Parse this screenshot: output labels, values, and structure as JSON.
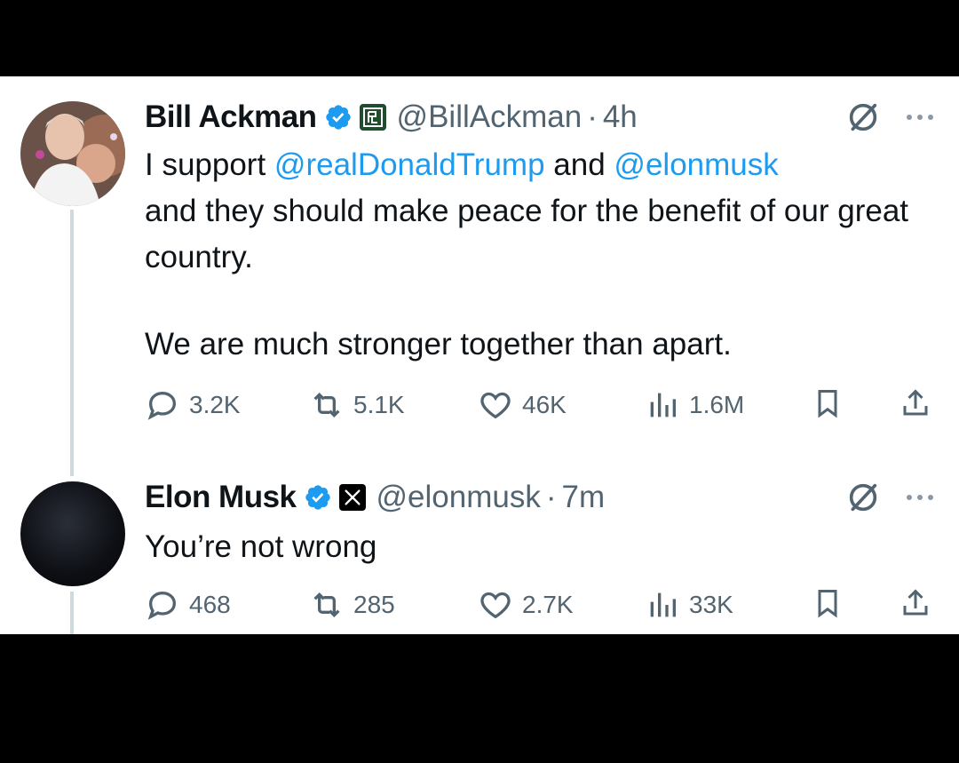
{
  "tweets": [
    {
      "name": "Bill Ackman",
      "handle": "@BillAckman",
      "separator": "·",
      "time": "4h",
      "text_parts": [
        {
          "t": "I support ",
          "mention": false
        },
        {
          "t": "@realDonaldTrump",
          "mention": true
        },
        {
          "t": " and ",
          "mention": false
        },
        {
          "t": "@elonmusk",
          "mention": true
        }
      ],
      "line2": "and they should make peace for the benefit of our great country.",
      "line3": "We are much stronger together than apart.",
      "replies": "3.2K",
      "reposts": "5.1K",
      "likes": "46K",
      "views": "1.6M",
      "affiliation_icon": "pershing-square-badge",
      "avatar": "photo-avatar"
    },
    {
      "name": "Elon Musk",
      "handle": "@elonmusk",
      "separator": "·",
      "time": "7m",
      "text": "You’re not wrong",
      "replies": "468",
      "reposts": "285",
      "likes": "2.7K",
      "views": "33K",
      "affiliation_icon": "x-logo-badge",
      "avatar": "dark-avatar"
    }
  ],
  "colors": {
    "mention": "#1d9bf0",
    "verified": "#1d9bf0",
    "secondary_text": "#536471",
    "background": "#ffffff",
    "letterbox": "#000000"
  }
}
